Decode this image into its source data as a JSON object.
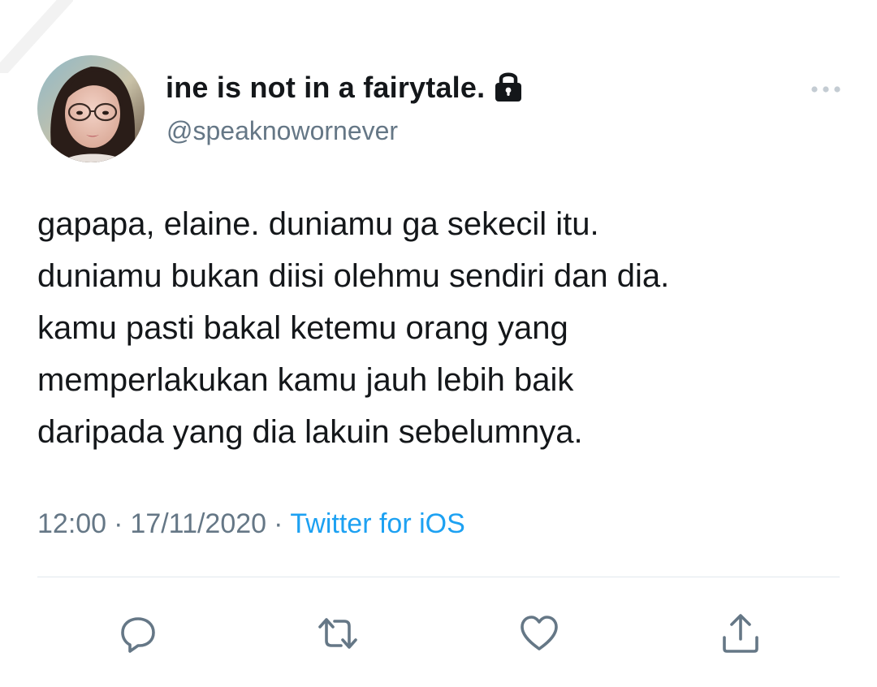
{
  "tweet": {
    "author": {
      "display_name": "ine is not in a fairytale.",
      "handle": "@speaknowornever",
      "protected_icon": "lock-icon",
      "avatar": "profile-photo"
    },
    "text_lines": [
      "gapapa, elaine. duniamu ga sekecil itu.",
      "duniamu bukan diisi olehmu sendiri dan dia.",
      "kamu pasti bakal ketemu orang yang",
      "memperlakukan kamu jauh lebih baik",
      "daripada yang dia lakuin sebelumnya."
    ],
    "meta": {
      "time": "12:00",
      "date": "17/11/2020",
      "separator": "·",
      "source": "Twitter for iOS"
    },
    "more_icon": "more-options-icon",
    "actions": [
      {
        "name": "reply",
        "icon": "reply-icon"
      },
      {
        "name": "retweet",
        "icon": "retweet-icon"
      },
      {
        "name": "like",
        "icon": "heart-icon"
      },
      {
        "name": "share",
        "icon": "share-icon"
      }
    ]
  },
  "colors": {
    "text_primary": "#14171a",
    "text_secondary": "#657786",
    "link": "#1da1f2",
    "divider": "#e1e8ed",
    "icon": "#657786"
  }
}
